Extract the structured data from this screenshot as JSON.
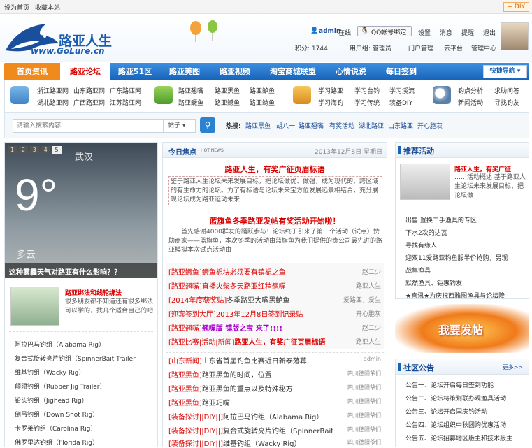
{
  "topbar": {
    "home": "设为首页",
    "fav": "收藏本站",
    "diy": "DIY"
  },
  "logo": {
    "cn": "路亚人生",
    "url": "www.GoLure.cn"
  },
  "user": {
    "name": "admin",
    "online": "在线",
    "qq": "QQ帐号绑定",
    "links": [
      "设置",
      "消息",
      "提醒",
      "退出"
    ],
    "credit": "积分: 1744",
    "group": "用户组: 管理员",
    "links2": [
      "门户管理",
      "云平台",
      "管理中心"
    ]
  },
  "nav": {
    "items": [
      "首页资讯",
      "路亚论坛",
      "路亚51区",
      "路亚美图",
      "路亚视频",
      "淘宝商城联盟",
      "心情说说",
      "每日签到"
    ],
    "quick": "快捷导航"
  },
  "sub": {
    "g1": [
      "浙江路亚网",
      "山东路亚网",
      "广东路亚网",
      "湖北路亚网",
      "广西路亚网",
      "江苏路亚网"
    ],
    "g2": [
      "路亚翘嘴",
      "路亚黑鱼",
      "路亚鲈鱼",
      "路亚鳜鱼",
      "路亚鳡鱼",
      "路亚鲶鱼"
    ],
    "g3": [
      "学习路亚",
      "学习台钓",
      "学习溪流",
      "学习海钓",
      "学习传统",
      "装备DIY"
    ],
    "g4": [
      "钓点分析",
      "求助问答",
      "新闻活动",
      "寻找钓友"
    ]
  },
  "search": {
    "placeholder": "请输入搜索内容",
    "type": "帖子",
    "hot_label": "热搜:",
    "hot": [
      "路亚黑鱼",
      "胡八一",
      "路亚翘嘴",
      "有奖活动",
      "湖北路亚",
      "山东路亚",
      "开心胞灰"
    ]
  },
  "slide": {
    "nums": [
      "1",
      "2",
      "3",
      "4",
      "5"
    ],
    "city": "武汉",
    "temp": "9°",
    "cond": "多云",
    "caption": "这种雾霾天气对路亚有什么影响？？",
    "img_title": "路亚绑法和线轮绑法",
    "img_desc": "很多朋友都不知道还有很多绑法可以学的，找几个适合自己的吧"
  },
  "rigs": [
    "阿拉巴马钓组（Alabama Rig）",
    "复合式旋转亮片钓组（SpinnerBait Trailer",
    "维基钓组（Wacky Rig）",
    "颠须钓组（Rubber Jig Trailer）",
    "铅头钓组（Jighead Rig）",
    "倒吊钓组（Down Shot Rig）",
    "卡罗莱钓组（Carolina Rig）",
    "佛罗里达钓组（Florida Rig）"
  ],
  "today": {
    "title": "今日焦点",
    "tag": "HOT NEWS",
    "date": "2013年12月8日 星期日",
    "h1": "路亚人生，有奖广征页眉标语",
    "s1": "鉴于路亚人生论坛未来发展目标，把论坛做优、做强，成为现代的、跨区域的有生命力的论坛。为了有标语与论坛未来宝方位发展远景相结合，充分展现论坛成为路亚运动未来",
    "h2": "蓝旗鱼冬季路亚发帖有奖活动开始啦！",
    "s2": "首先感谢4000群友的踊跃参与！论坛终于引来了第一个活动（试点）赞助商家——蓝旗鱼，本次冬季的活动由蓝旗鱼为我们提供的贵公司最先进的路亚模拟本次试点活动由"
  },
  "posts1": [
    {
      "tag": "[路亚鳜鱼]",
      "title": "鳜鱼栀块必须要有镇栀之鱼",
      "author": "赵二少"
    },
    {
      "tag": "[路亚翘嘴]",
      "title": "直播火柴冬天路亚红稍翘嘴",
      "author": "路亚人生"
    },
    {
      "tag": "[2014年度获奖贴]",
      "title": "冬季路亚大嘴黑鲈鱼",
      "author": "爱路亚，爱生"
    },
    {
      "tag": "[迎宾签到大厅]",
      "title": "2013年12月8日签到记录贴",
      "author": "开心胞灰"
    },
    {
      "tag": "[路亚翘嘴]",
      "title": "翘嘴版 镇版之宝 来了!!!!",
      "author": "赵二少"
    },
    {
      "tag": "[路亚比赛|活动|新闻]",
      "title": "路亚人生，有奖广征页眉标语",
      "author": "路亚人生"
    }
  ],
  "posts2": [
    {
      "tag": "[山东新闻]",
      "title": "山东省首届钓鱼比赛近日新泰落幕",
      "author": "admin"
    },
    {
      "tag": "[路亚黑鱼]",
      "title": "路亚黑鱼的时间，位置",
      "author": "四川德阳爷们"
    },
    {
      "tag": "[路亚黑鱼]",
      "title": "路亚黑鱼的重点以及特殊秘方",
      "author": "四川德阳爷们"
    },
    {
      "tag": "[路亚黑鱼]",
      "title": "路亚巧嘴",
      "author": "四川德阳爷们"
    },
    {
      "tag": "[装备探讨||DIY||]",
      "title": "阿拉巴马钓组（Alabama Rig）",
      "author": "四川德阳爷们"
    },
    {
      "tag": "[装备探讨||DIY||]",
      "title": "复合式旋转亮片钓组（SpinnerBait",
      "author": "四川德阳爷们"
    },
    {
      "tag": "[装备探讨||DIY||]",
      "title": "维基钓组（Wacky Rig）",
      "author": "四川德阳爷们"
    }
  ],
  "recommend": {
    "title": "推荐活动",
    "img_title": "路亚人生，有奖广征",
    "img_desc": "……活动概述 基于路亚人生论坛未来发展目标，把论坛做",
    "items": [
      "出售 置换二手渔具的专区",
      "下水2次的达瓦",
      "寻找有缘人",
      "迎双11爱路亚钓鱼服半价抢购，另现",
      "战隼渔具",
      "默然渔具、钜惠钓友",
      "★喜讯★为庆祝西雅图渔具与论坛隆"
    ]
  },
  "post_btn": "我要发帖",
  "notice": {
    "title": "社区公告",
    "more": "更多>>",
    "items": [
      "公告一、论坛开启每日签到功能",
      "公告二、论坛将策划联办观渔具活动",
      "公告三、论坛开启国庆钓活动",
      "公告四、论坛组织中秋团购优惠活动",
      "公告五、论坛招募地区版主和技术版主"
    ]
  }
}
